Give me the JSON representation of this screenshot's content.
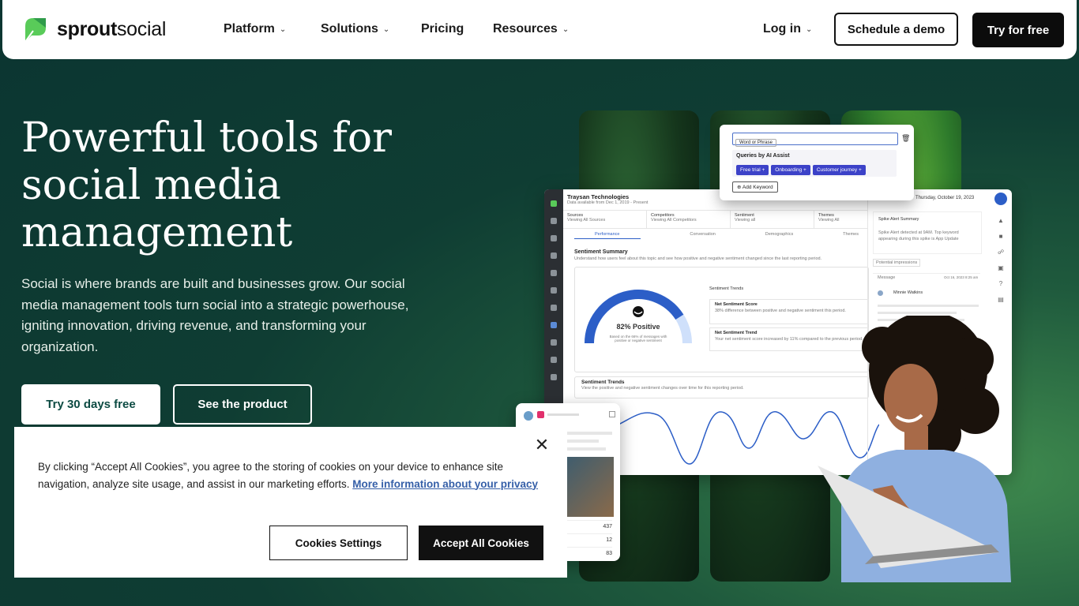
{
  "nav": {
    "logo_text_bold": "sprout",
    "logo_text_light": "social",
    "items": [
      {
        "label": "Platform",
        "has_dropdown": true
      },
      {
        "label": "Solutions",
        "has_dropdown": true
      },
      {
        "label": "Pricing",
        "has_dropdown": false
      },
      {
        "label": "Resources",
        "has_dropdown": true
      }
    ],
    "login_label": "Log in",
    "demo_label": "Schedule a demo",
    "try_label": "Try for free"
  },
  "hero": {
    "title": "Powerful tools for social media management",
    "subtitle": "Social is where brands are built and businesses grow. Our social media management tools turn social into a strategic powerhouse, igniting innovation, driving revenue, and transforming your organization.",
    "cta_primary": "Try 30 days free",
    "cta_secondary": "See the product"
  },
  "dashboard": {
    "company": "Traysan Technologies",
    "company_sub": "Data available from Dec 1, 2019 - Present",
    "filters": [
      {
        "label": "Sources",
        "value": "Viewing All Sources"
      },
      {
        "label": "Competitors",
        "value": "Viewing All Competitors"
      },
      {
        "label": "Sentiment",
        "value": "Viewing all"
      },
      {
        "label": "Themes",
        "value": "Viewing All"
      }
    ],
    "tabs": [
      "Performance",
      "Conversation",
      "Demographics",
      "Themes"
    ],
    "summary_title": "Sentiment Summary",
    "summary_sub": "Understand how users feel about this topic and see how positive and negative sentiment changed since the last reporting period.",
    "gauge_value": 82,
    "gauge_label": "82% Positive",
    "gauge_note": "Based on the 66% of messages with positive or negative sentiment",
    "trends_heading": "Sentiment Trends",
    "net_score_title": "Net Sentiment Score",
    "net_score_text": "38% difference between positive and negative sentiment this period.",
    "net_trend_title": "Net Sentiment Trend",
    "net_trend_text": "Your net sentiment score increased by 11% compared to the previous period.",
    "trends_title": "Sentiment Trends",
    "trends_sub": "View the positive and negative sentiment changes over time for this reporting period.",
    "date_header": "Thursday, October 19, 2023",
    "alert_title": "Spike Alert Summary",
    "alert_text": "Spike Alert detected at 9AM. Top keyword appearing during this spike is App Update",
    "message_label": "Message",
    "message_date": "Oct 16, 2023 8:25 am",
    "user_name": "Minnie Watkins",
    "potential_label": "Potential impressions",
    "add_label": "Add"
  },
  "query_card": {
    "dropdown": "Word or Phrase",
    "heading": "Queries by AI Assist",
    "chips": [
      "Free trial",
      "Onboarding",
      "Customer journey"
    ],
    "add_keyword": "Add Keyword"
  },
  "phone_card": {
    "stats": [
      "437",
      "12",
      "83"
    ]
  },
  "cookie": {
    "text": "By clicking “Accept All Cookies”, you agree to the storing of cookies on your device to enhance site navigation, analyze site usage, and assist in our marketing efforts.",
    "link": "More information about your privacy",
    "settings_label": "Cookies Settings",
    "accept_label": "Accept All Cookies",
    "close_glyph": "✕"
  },
  "colors": {
    "brand_green": "#59cb59",
    "hero_bg": "#0f3d33",
    "chip_blue": "#3c42c8",
    "gauge_blue": "#2c5ec7",
    "link_blue": "#355fa8"
  }
}
